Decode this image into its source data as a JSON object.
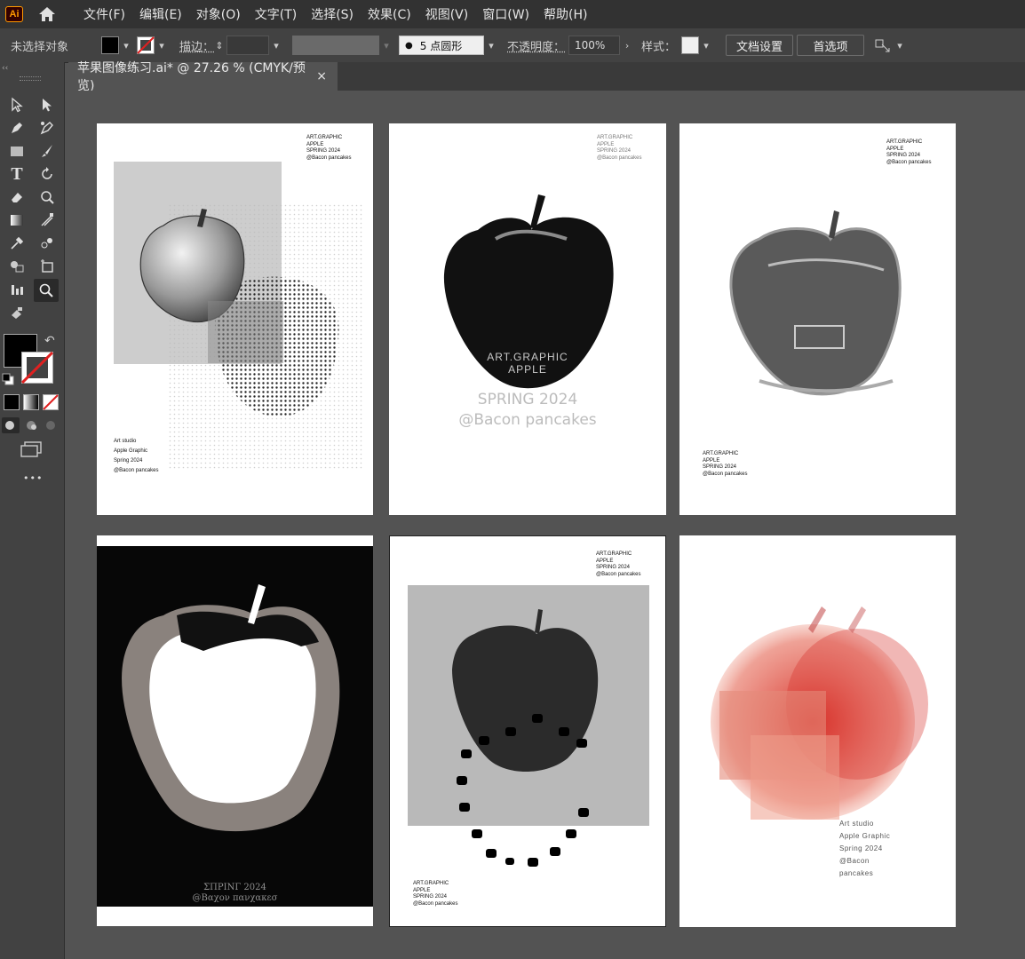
{
  "app": {
    "logo": "Ai",
    "home_icon": "home-icon"
  },
  "menu": [
    "文件(F)",
    "编辑(E)",
    "对象(O)",
    "文字(T)",
    "选择(S)",
    "效果(C)",
    "视图(V)",
    "窗口(W)",
    "帮助(H)"
  ],
  "control": {
    "selection": "未选择对象",
    "stroke_label": "描边：",
    "brush_value": "5 点圆形",
    "opacity_label": "不透明度：",
    "opacity_value": "100%",
    "style_label": "样式：",
    "doc_setup": "文档设置",
    "prefs": "首选项"
  },
  "document": {
    "tab_title": "苹果图像练习.ai* @ 27.26 % (CMYK/预览)",
    "close": "×"
  },
  "toolbar": {
    "collapse": "‹‹",
    "more": "•••"
  },
  "artboards": [
    {
      "text": "ART.GRAPHIC\nAPPLE\nSPRING 2024\n@Bacon pancakes",
      "footer": "Art studio\nApple Graphic\nSpring 2024\n@Bacon pancakes"
    },
    {
      "text": "ART.GRAPHIC\nAPPLE\nSPRING 2024\n@Bacon pancakes",
      "overlay_title": "ART.GRAPHIC\nAPPLE",
      "overlay_sub": "SPRING 2024\n@Bacon pancakes"
    },
    {
      "text": "ART.GRAPHIC\nAPPLE\nSPRING 2024\n@Bacon pancakes",
      "footer": "ART.GRAPHIC\nAPPLE\nSPRING 2024\n@Bacon pancakes"
    },
    {
      "footer": "ΣΠΡΙΝΓ 2024\n@Βαχον πανχακεσ"
    },
    {
      "text": "ART.GRAPHIC\nAPPLE\nSPRING 2024\n@Bacon pancakes",
      "footer": "ART.GRAPHIC\nAPPLE\nSPRING 2024\n@Bacon pancakes"
    },
    {
      "footer": "Art studio\nApple Graphic\nSpring 2024\n@Bacon\npancakes"
    }
  ],
  "colors": {
    "menubar": "#323232",
    "panel": "#424242",
    "canvas": "#535353",
    "accent_red": "#d8322a"
  }
}
